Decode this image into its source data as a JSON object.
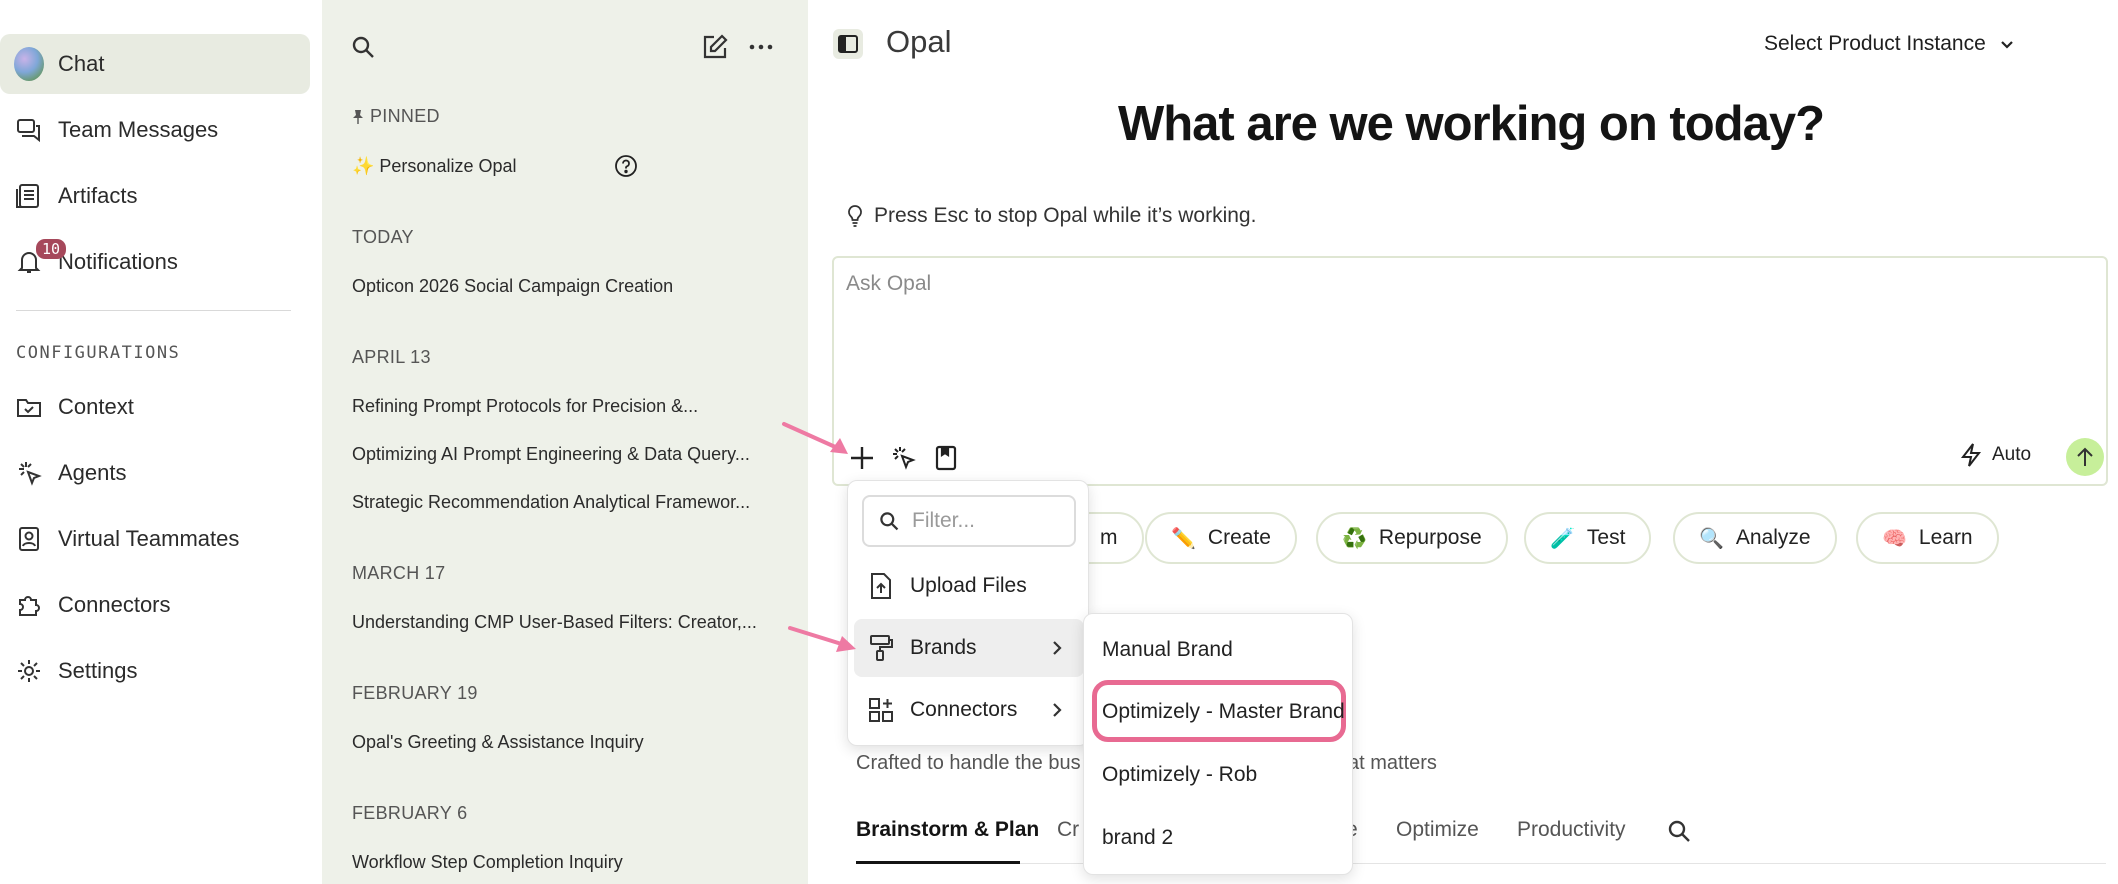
{
  "nav": {
    "items": [
      {
        "label": "Chat",
        "icon": "avatar",
        "active": true
      },
      {
        "label": "Team Messages",
        "icon": "chat-bubbles-icon"
      },
      {
        "label": "Artifacts",
        "icon": "document-icon"
      },
      {
        "label": "Notifications",
        "icon": "bell-icon",
        "badge": "10"
      },
      {
        "label": "Context",
        "icon": "folder-check-icon"
      },
      {
        "label": "Agents",
        "icon": "sparkle-cursor-icon"
      },
      {
        "label": "Virtual Teammates",
        "icon": "person-badge-icon"
      },
      {
        "label": "Connectors",
        "icon": "puzzle-icon"
      },
      {
        "label": "Settings",
        "icon": "gear-icon"
      }
    ],
    "config_label": "CONFIGURATIONS"
  },
  "history": {
    "pinned_label": "PINNED",
    "pinned_item": "✨ Personalize Opal",
    "sections": [
      {
        "label": "TODAY",
        "items": [
          "Opticon 2026 Social Campaign Creation"
        ]
      },
      {
        "label": "APRIL 13",
        "items": [
          "Refining Prompt Protocols for Precision &...",
          "Optimizing AI Prompt Engineering & Data Query...",
          "Strategic Recommendation Analytical Framewor..."
        ]
      },
      {
        "label": "MARCH 17",
        "items": [
          "Understanding CMP User-Based Filters: Creator,..."
        ]
      },
      {
        "label": "FEBRUARY 19",
        "items": [
          "Opal's Greeting & Assistance Inquiry"
        ]
      },
      {
        "label": "FEBRUARY 6",
        "items": [
          "Workflow Step Completion Inquiry"
        ]
      }
    ]
  },
  "main": {
    "app_title": "Opal",
    "instance_select": "Select Product Instance",
    "headline": "What are we working on today?",
    "tip": "Press Esc to stop Opal while it’s working.",
    "ask_placeholder": "Ask Opal",
    "auto_label": "Auto",
    "chips": [
      {
        "emoji": "",
        "label": "m"
      },
      {
        "emoji": "✏️",
        "label": "Create"
      },
      {
        "emoji": "♻️",
        "label": "Repurpose"
      },
      {
        "emoji": "🧪",
        "label": "Test"
      },
      {
        "emoji": "🔍",
        "label": "Analyze"
      },
      {
        "emoji": "🧠",
        "label": "Learn"
      }
    ],
    "crafted_text": "Crafted to handle the bus",
    "crafted_tail": "at matters",
    "tabs": [
      "Brainstorm & Plan",
      "Cr",
      "e",
      "Optimize",
      "Productivity"
    ]
  },
  "menu": {
    "filter_placeholder": "Filter...",
    "items": [
      "Upload Files",
      "Brands",
      "Connectors"
    ]
  },
  "brands_menu": {
    "items": [
      "Manual Brand",
      "Optimizely - Master Brand",
      "Optimizely - Rob",
      "brand 2"
    ]
  },
  "colors": {
    "accent_green": "#c7ef9a",
    "highlight_pink": "#e86a92",
    "sidebar_bg": "#eef1e9",
    "badge": "#a6485b"
  }
}
